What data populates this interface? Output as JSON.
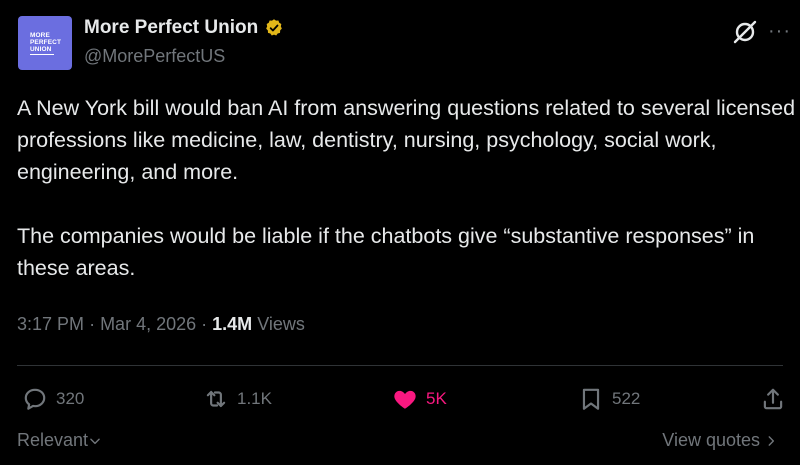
{
  "author": {
    "avatar_lines": [
      "MORE",
      "PERFECT",
      "UNION"
    ],
    "display_name": "More Perfect Union",
    "handle": "@MorePerfectUS"
  },
  "tweet": {
    "paragraphs": [
      "A New York bill would ban AI from answering questions related to several licensed professions like medicine, law, dentistry, nursing, psychology, social work, engineering, and more.",
      "The companies would be liable if the chatbots give “substantive responses” in these areas."
    ],
    "time": "3:17 PM",
    "date": "Mar 4, 2026",
    "views_count": "1.4M",
    "views_label": "Views"
  },
  "actions": {
    "replies": "320",
    "reposts": "1.1K",
    "likes": "5K",
    "bookmarks": "522"
  },
  "footer": {
    "sort_label": "Relevant",
    "view_quotes_label": "View quotes"
  },
  "icons": [
    "verified-badge-icon",
    "grok-icon",
    "more-icon",
    "reply-icon",
    "repost-icon",
    "like-icon",
    "bookmark-icon",
    "share-icon",
    "chevron-down-icon",
    "chevron-right-icon"
  ],
  "colors": {
    "background": "#000000",
    "text": "#e7e9ea",
    "muted": "#71767b",
    "like": "#f91880",
    "verified_gold": "#e2b719",
    "avatar": "#6b6ee0"
  }
}
